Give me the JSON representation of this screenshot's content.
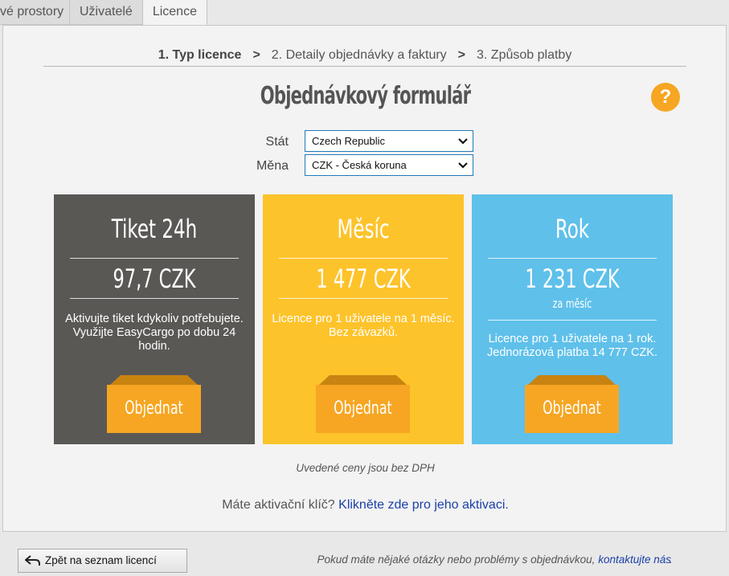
{
  "tabs": [
    {
      "label": "vé prostory"
    },
    {
      "label": "Uživatelé"
    },
    {
      "label": "Licence",
      "active": true
    }
  ],
  "steps": [
    {
      "label": "1. Typ licence",
      "current": true
    },
    {
      "label": "2. Detaily objednávky a faktury"
    },
    {
      "label": "3. Způsob platby"
    }
  ],
  "step_separator": ">",
  "title": "Objednávkový formulář",
  "help_label": "?",
  "form": {
    "state_label": "Stát",
    "state_value": "Czech Republic",
    "currency_label": "Měna",
    "currency_value": "CZK - Česká koruna"
  },
  "cards": [
    {
      "name": "Tiket 24h",
      "price": "97,7 CZK",
      "description": "Aktivujte tiket kdykoliv potřebujete. Využijte EasyCargo po dobu 24 hodin.",
      "button": "Objednat",
      "color": "#5a5855"
    },
    {
      "name": "Měsíc",
      "price": "1 477 CZK",
      "description": "Licence pro 1 uživatele na 1 měsíc. Bez závazků.",
      "button": "Objednat",
      "color": "#fdc32b"
    },
    {
      "name": "Rok",
      "price": "1 231 CZK",
      "per": "za měsíc",
      "description": "Licence pro 1 uživatele na 1 rok. Jednorázová platba 14 777 CZK.",
      "button": "Objednat",
      "color": "#5fc0ea"
    }
  ],
  "button_color": "#f6a623",
  "note": "Uvedené ceny jsou bez DPH",
  "activation": {
    "text": "Máte aktivační klíč?",
    "link": "Klikněte zde pro jeho aktivaci."
  },
  "back_button": "Zpět na seznam licencí",
  "footer": {
    "text": "Pokud máte nějaké otázky nebo problémy s objednávkou,",
    "link": "kontaktujte nás",
    "tail": "."
  }
}
